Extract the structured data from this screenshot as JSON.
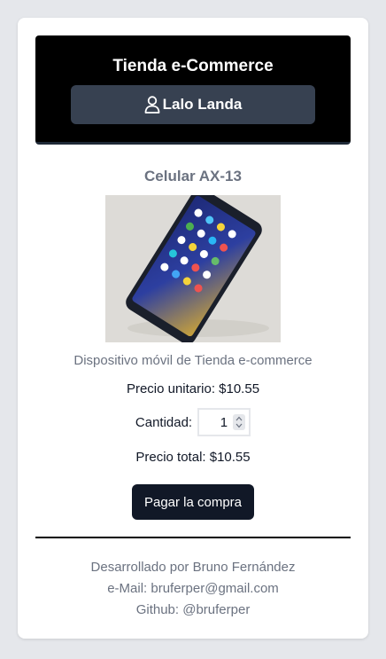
{
  "header": {
    "title": "Tienda e-Commerce",
    "user_name": "Lalo Landa",
    "user_icon": "user-icon"
  },
  "product": {
    "name": "Celular AX-13",
    "image_icon": "smartphone-photo",
    "description": "Dispositivo móvil de Tienda e-commerce",
    "unit_price_text": "Precio unitario: $10.55",
    "quantity_label": "Cantidad:",
    "quantity_value": "1",
    "total_price_text": "Precio total: $10.55"
  },
  "actions": {
    "pay_label": "Pagar la compra"
  },
  "footer": {
    "developer": "Desarrollado por Bruno Fernández",
    "email": "e-Mail: bruferper@gmail.com",
    "github": "Github: @bruferper"
  },
  "colors": {
    "page_background": "#e5e7eb",
    "header_background": "#000000",
    "user_button_background": "#374151",
    "pay_button_background": "#111827",
    "muted_text": "#6b7280"
  }
}
